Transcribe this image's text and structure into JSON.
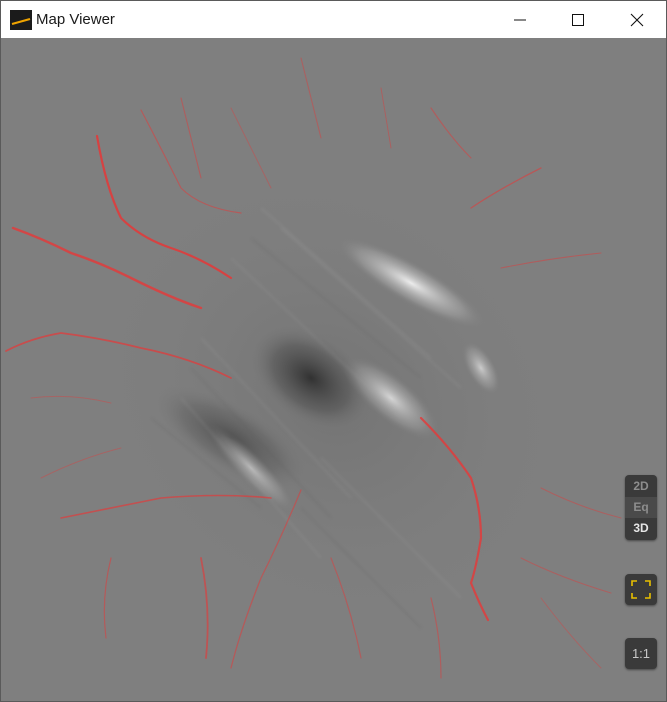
{
  "window": {
    "title": "Map Viewer",
    "icon": "app-logo-icon",
    "controls": [
      "minimize-icon",
      "maximize-icon",
      "close-icon"
    ]
  },
  "map": {
    "background_color": "#7f7f7f",
    "river_color": "#e03c3c",
    "view_modes": [
      {
        "label": "2D",
        "active": false
      },
      {
        "label": "Eq",
        "active": false
      },
      {
        "label": "3D",
        "active": true
      }
    ],
    "fit_icon": "fit-to-extent-icon",
    "ratio_label": "1:1",
    "scale_bar_color": "#e8c000"
  }
}
